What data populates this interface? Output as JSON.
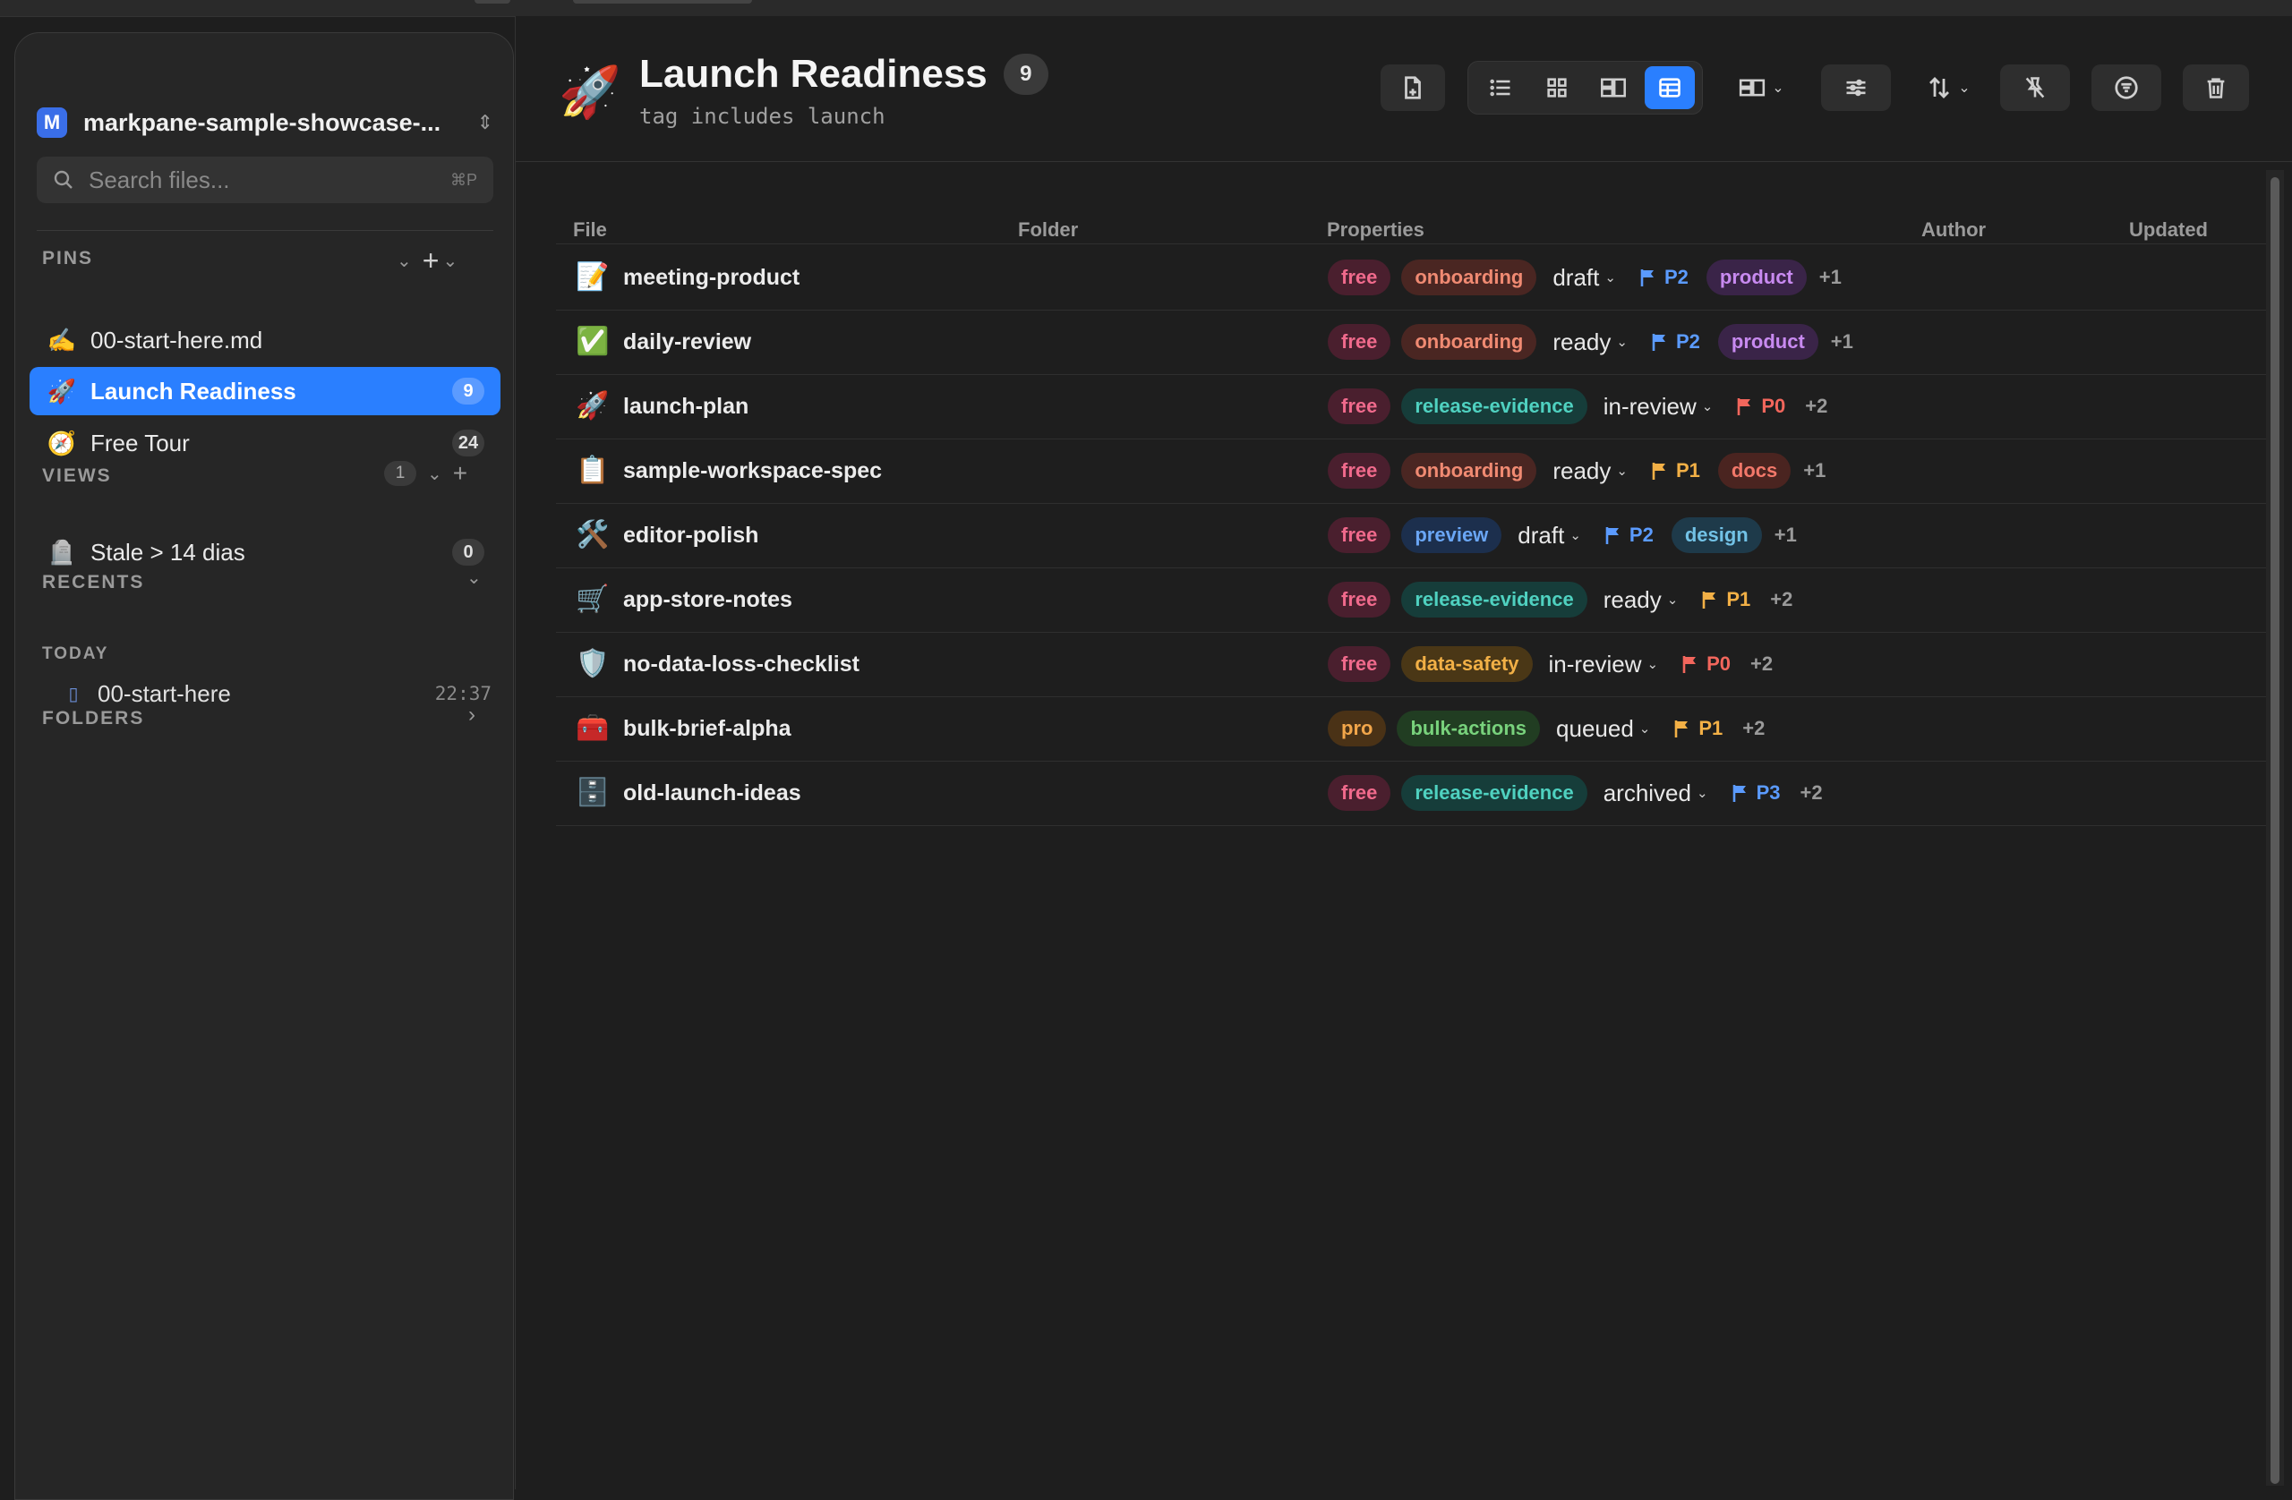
{
  "window": {
    "title": "Launch Readiness"
  },
  "sidebar": {
    "workspace": {
      "badge": "M",
      "name": "markpane-sample-showcase-..."
    },
    "search": {
      "placeholder": "Search files...",
      "shortcut": "⌘P"
    },
    "pins": {
      "title": "PINS",
      "items": [
        {
          "emoji": "✍️",
          "label": "00-start-here.md",
          "count": ""
        },
        {
          "emoji": "🚀",
          "label": "Launch Readiness",
          "count": "9",
          "active": true
        },
        {
          "emoji": "🧭",
          "label": "Free Tour",
          "count": "24"
        }
      ]
    },
    "views": {
      "title": "VIEWS",
      "count": "1",
      "items": [
        {
          "emoji": "🪦",
          "label": "Stale > 14 dias",
          "count": "0"
        }
      ]
    },
    "recents": {
      "title": "RECENTS",
      "today": "TODAY",
      "items": [
        {
          "label": "00-start-here",
          "time": "22:37"
        }
      ]
    },
    "folders": {
      "title": "FOLDERS"
    }
  },
  "header": {
    "emoji": "🚀",
    "title": "Launch Readiness",
    "count": "9",
    "subtitle": "tag includes launch"
  },
  "table": {
    "columns": {
      "file": "File",
      "folder": "Folder",
      "properties": "Properties",
      "author": "Author",
      "updated": "Updated"
    },
    "rows": [
      {
        "icon": "📝",
        "name": "meeting-product",
        "plan": "free",
        "tag": "onboarding",
        "tagType": "onboarding",
        "status": "draft",
        "prio": "P2",
        "extra": "product",
        "extraType": "product",
        "more": "+1"
      },
      {
        "icon": "✅",
        "name": "daily-review",
        "plan": "free",
        "tag": "onboarding",
        "tagType": "onboarding",
        "status": "ready",
        "prio": "P2",
        "extra": "product",
        "extraType": "product",
        "more": "+1"
      },
      {
        "icon": "🚀",
        "name": "launch-plan",
        "plan": "free",
        "tag": "release-evidence",
        "tagType": "release",
        "status": "in-review",
        "prio": "P0",
        "extra": "",
        "more": "+2"
      },
      {
        "icon": "📋",
        "name": "sample-workspace-spec",
        "plan": "free",
        "tag": "onboarding",
        "tagType": "onboarding",
        "status": "ready",
        "prio": "P1",
        "extra": "docs",
        "extraType": "docs",
        "more": "+1"
      },
      {
        "icon": "🛠️",
        "name": "editor-polish",
        "plan": "free",
        "tag": "preview",
        "tagType": "preview",
        "status": "draft",
        "prio": "P2",
        "extra": "design",
        "extraType": "design",
        "more": "+1"
      },
      {
        "icon": "🛒",
        "name": "app-store-notes",
        "plan": "free",
        "tag": "release-evidence",
        "tagType": "release",
        "status": "ready",
        "prio": "P1",
        "extra": "",
        "more": "+2"
      },
      {
        "icon": "🛡️",
        "name": "no-data-loss-checklist",
        "plan": "free",
        "tag": "data-safety",
        "tagType": "safety",
        "status": "in-review",
        "prio": "P0",
        "extra": "",
        "more": "+2"
      },
      {
        "icon": "🧰",
        "name": "bulk-brief-alpha",
        "plan": "pro",
        "tag": "bulk-actions",
        "tagType": "bulk",
        "status": "queued",
        "prio": "P1",
        "extra": "",
        "more": "+2"
      },
      {
        "icon": "🗄️",
        "name": "old-launch-ideas",
        "plan": "free",
        "tag": "release-evidence",
        "tagType": "release",
        "status": "archived",
        "prio": "P3",
        "extra": "",
        "more": "+2"
      }
    ]
  },
  "colors": {
    "accent": "#2a7fff",
    "pill": {
      "free": [
        "#4a1f2e",
        "#f06a8c"
      ],
      "pro": [
        "#4a3216",
        "#f2a64a"
      ],
      "onboarding": [
        "#4a2622",
        "#f08a72"
      ],
      "release": [
        "#163d3a",
        "#4fd1c0"
      ],
      "preview": [
        "#1c2f4d",
        "#6aa6f5"
      ],
      "safety": [
        "#4a3716",
        "#f2b046"
      ],
      "bulk": [
        "#213d22",
        "#78d27c"
      ],
      "product": [
        "#3a2448",
        "#c88af0"
      ],
      "docs": [
        "#4a2420",
        "#f2786a"
      ],
      "design": [
        "#1e3a4a",
        "#72c2e6"
      ]
    },
    "prio": {
      "P0": "#f2665c",
      "P1": "#f2b046",
      "P2": "#5b9bff",
      "P3": "#5b9bff"
    }
  }
}
